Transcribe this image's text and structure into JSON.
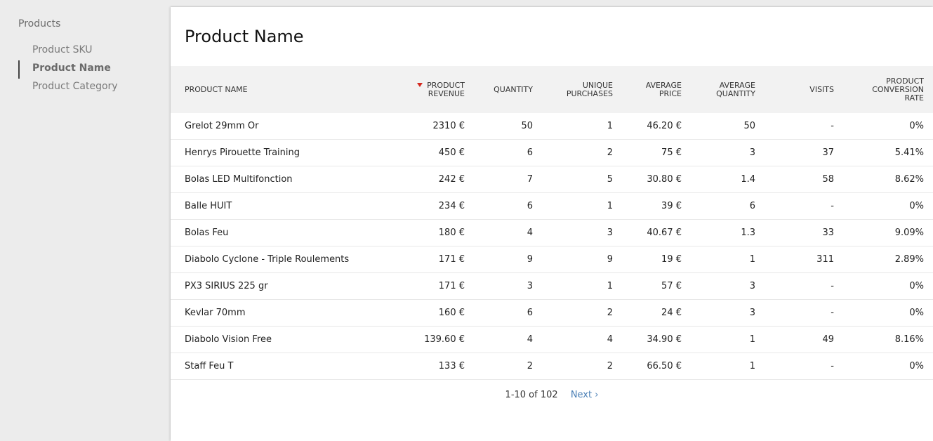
{
  "sidebar": {
    "group_title": "Products",
    "items": [
      {
        "label": "Product SKU",
        "active": false
      },
      {
        "label": "Product Name",
        "active": true
      },
      {
        "label": "Product Category",
        "active": false
      }
    ]
  },
  "report": {
    "title": "Product Name",
    "columns": [
      "PRODUCT NAME",
      "PRODUCT REVENUE",
      "QUANTITY",
      "UNIQUE PURCHASES",
      "AVERAGE PRICE",
      "AVERAGE QUANTITY",
      "VISITS",
      "PRODUCT CONVERSION RATE"
    ],
    "sorted_column": "PRODUCT REVENUE",
    "sort_direction": "desc",
    "sort_color": "#d4291f",
    "rows": [
      [
        "Grelot 29mm Or",
        "2310 €",
        "50",
        "1",
        "46.20 €",
        "50",
        "-",
        "0%"
      ],
      [
        "Henrys Pirouette Training",
        "450 €",
        "6",
        "2",
        "75 €",
        "3",
        "37",
        "5.41%"
      ],
      [
        "Bolas LED Multifonction",
        "242 €",
        "7",
        "5",
        "30.80 €",
        "1.4",
        "58",
        "8.62%"
      ],
      [
        "Balle HUIT",
        "234 €",
        "6",
        "1",
        "39 €",
        "6",
        "-",
        "0%"
      ],
      [
        "Bolas Feu",
        "180 €",
        "4",
        "3",
        "40.67 €",
        "1.3",
        "33",
        "9.09%"
      ],
      [
        "Diabolo Cyclone - Triple Roulements",
        "171 €",
        "9",
        "9",
        "19 €",
        "1",
        "311",
        "2.89%"
      ],
      [
        "PX3 SIRIUS 225 gr",
        "171 €",
        "3",
        "1",
        "57 €",
        "3",
        "-",
        "0%"
      ],
      [
        "Kevlar 70mm",
        "160 €",
        "6",
        "2",
        "24 €",
        "3",
        "-",
        "0%"
      ],
      [
        "Diabolo Vision Free",
        "139.60 €",
        "4",
        "4",
        "34.90 €",
        "1",
        "49",
        "8.16%"
      ],
      [
        "Staff Feu T",
        "133 €",
        "2",
        "2",
        "66.50 €",
        "1",
        "-",
        "0%"
      ]
    ]
  },
  "pagination": {
    "range_text": "1-10 of 102",
    "next_label": "Next ›"
  }
}
